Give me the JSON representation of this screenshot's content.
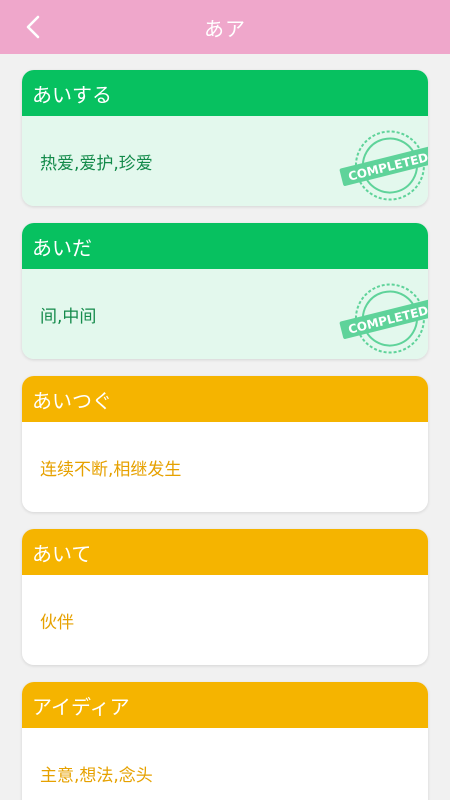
{
  "header": {
    "title": "あア"
  },
  "stamp": {
    "text": "COMPLETED"
  },
  "colors": {
    "header_bg": "#efa7cb",
    "done_accent": "#07c160",
    "todo_accent": "#f5b400"
  },
  "words": [
    {
      "kana": "あいする",
      "meaning": "热爱,爱护,珍爱",
      "status": "completed"
    },
    {
      "kana": "あいだ",
      "meaning": "间,中间",
      "status": "completed"
    },
    {
      "kana": "あいつぐ",
      "meaning": "连续不断,相继发生",
      "status": "pending"
    },
    {
      "kana": "あいて",
      "meaning": "伙伴",
      "status": "pending"
    },
    {
      "kana": "アイディア",
      "meaning": "主意,想法,念头",
      "status": "pending"
    }
  ]
}
